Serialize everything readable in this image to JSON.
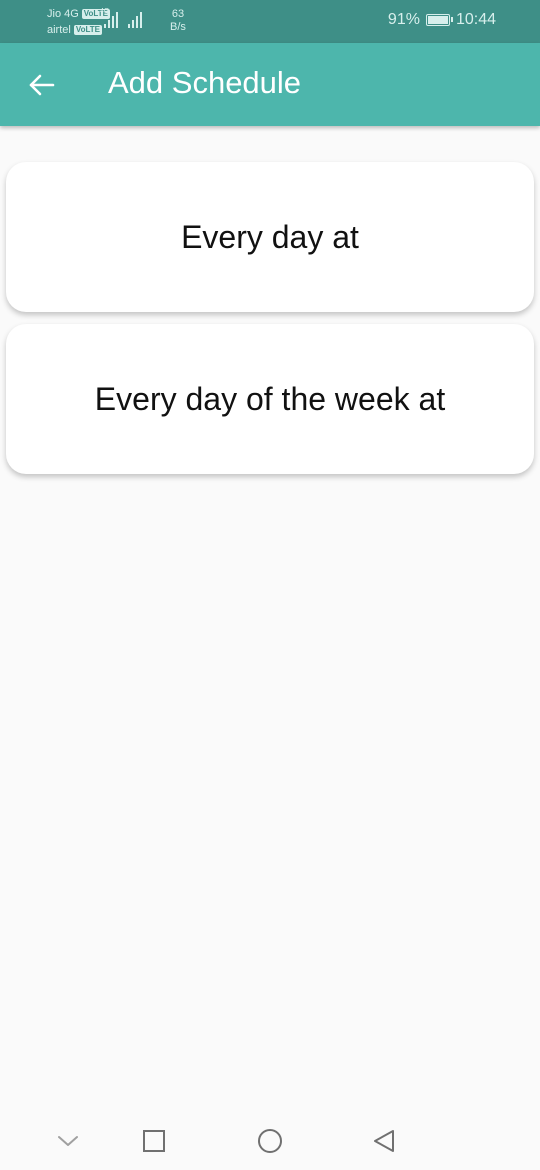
{
  "status_bar": {
    "carrier1": "Jio 4G",
    "carrier1_badge": "VoLTE",
    "carrier2": "airtel",
    "carrier2_badge": "VoLTE",
    "network_type": "4G",
    "speed_value": "63",
    "speed_unit": "B/s",
    "battery_percent": "91%",
    "time": "10:44"
  },
  "app_bar": {
    "back_icon": "arrow-back-icon",
    "title": "Add Schedule",
    "color": "#4db6ac"
  },
  "options": [
    {
      "label": "Every day at"
    },
    {
      "label": "Every day of the week at"
    }
  ],
  "nav_bar": {
    "icons": [
      "chevron-down-icon",
      "square-recent-icon",
      "circle-home-icon",
      "triangle-back-icon"
    ]
  }
}
